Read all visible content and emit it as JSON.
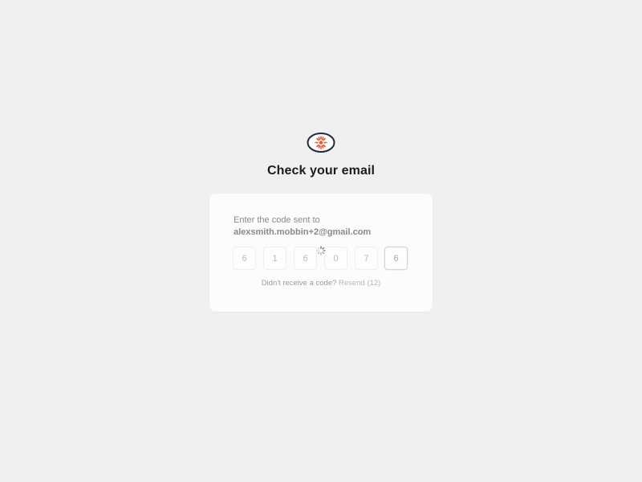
{
  "header": {
    "title": "Check your email",
    "logo_icon": "sun-eye-logo-icon"
  },
  "verification": {
    "instruction": "Enter the code sent to",
    "email": "alexsmith.mobbin+2@gmail.com",
    "code_digits": [
      "6",
      "1",
      "6",
      "0",
      "7",
      "6"
    ],
    "loading_icon": "spinner-icon"
  },
  "resend": {
    "prompt": "Didn't receive a code?",
    "link_label": "Resend (12)"
  },
  "colors": {
    "background": "#f0f0f0",
    "card": "#fcfcfc",
    "logo_outline": "#1f2d3a",
    "logo_accent": "#e4572e"
  }
}
